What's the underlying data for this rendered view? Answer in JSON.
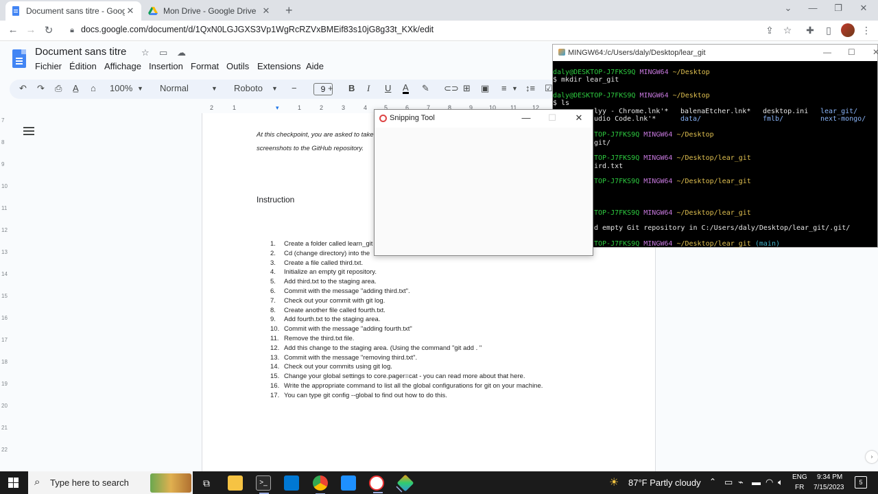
{
  "browser": {
    "tabs": [
      {
        "title": "Document sans titre - Google Do",
        "active": true
      },
      {
        "title": "Mon Drive - Google Drive",
        "active": false
      }
    ],
    "url": "docs.google.com/document/d/1QxN0LGJGXS3Vp1WgRcRZVxBMEif83s10jG8g33t_KXk/edit"
  },
  "docs": {
    "title": "Document sans titre",
    "menu": [
      "Fichier",
      "Édition",
      "Affichage",
      "Insertion",
      "Format",
      "Outils",
      "Extensions",
      "Aide"
    ],
    "toolbar": {
      "zoom": "100%",
      "style": "Normal",
      "font": "Roboto",
      "font_size": "9"
    },
    "ruler": [
      "2",
      "1",
      "1",
      "2",
      "3",
      "4",
      "5",
      "6",
      "7",
      "8",
      "9",
      "10",
      "11",
      "12",
      "13"
    ],
    "vruler": [
      "7",
      "8",
      "9",
      "10",
      "11",
      "12",
      "13",
      "14",
      "15",
      "16",
      "17",
      "18",
      "19",
      "20",
      "21",
      "22"
    ],
    "page": {
      "intro_line1": "At this checkpoint, you are asked to take",
      "intro_line2": "screenshots to the GitHub repository.",
      "heading": "Instruction",
      "steps": [
        {
          "n": "1.",
          "text": "Create a folder called learn_git"
        },
        {
          "n": "2.",
          "text": "Cd (change directory) into the"
        },
        {
          "n": "3.",
          "text": "Create a file called third.txt."
        },
        {
          "n": "4.",
          "text": "Initialize an empty git repository."
        },
        {
          "n": "5.",
          "text": "Add third.txt to the staging area."
        },
        {
          "n": "6.",
          "text": "Commit with the message \"adding third.txt\"."
        },
        {
          "n": "7.",
          "text": "Check out your commit with git log."
        },
        {
          "n": "8.",
          "text": "Create another file called fourth.txt."
        },
        {
          "n": "9.",
          "text": "Add fourth.txt to the staging area."
        },
        {
          "n": "10.",
          "text": "Commit with the message \"adding fourth.txt\""
        },
        {
          "n": "11.",
          "text": "Remove the third.txt file."
        },
        {
          "n": "12.",
          "text": "Add this change to the staging area. (Using the command \"git add . \""
        },
        {
          "n": "13.",
          "text": "Commit with the message \"removing third.txt\"."
        },
        {
          "n": "14.",
          "text": "Check out your commits using git log."
        },
        {
          "n": "15.",
          "text": "Change your global settings to core.pager=cat - you can read more about that here."
        },
        {
          "n": "16.",
          "text": "Write the appropriate command to list all the global configurations for git on your machine."
        },
        {
          "n": "17.",
          "text": "You can type git config --global to find out how to do this."
        }
      ]
    }
  },
  "terminal": {
    "title": "MINGW64:/c/Users/daly/Desktop/lear_git",
    "prompt_user": "daly@DESKTOP-J7FKS9Q",
    "prompt_env": "MINGW64",
    "desktop_path": "~/Desktop",
    "repo_path": "~/Desktop/lear_git",
    "cmd_mkdir": "$ mkdir lear_git",
    "cmd_ls": "$ ls",
    "ls_row1": [
      "lyy - Chrome.lnk'*",
      "balenaEtcher.lnk*",
      "desktop.ini",
      "lear_git/"
    ],
    "ls_row2": [
      "udio Code.lnk'*",
      "data/",
      "fmlb/",
      "next-mongo/"
    ],
    "frag_prompt": "TOP-J7FKS9Q",
    "frag_git": "git/",
    "frag_third": "ird.txt",
    "init_msg": "d empty Git repository in C:/Users/daly/Desktop/lear_git/.git/",
    "branch": "(main)"
  },
  "snipping": {
    "title": "Snipping Tool"
  },
  "taskbar": {
    "search_placeholder": "Type here to search",
    "weather": "87°F  Partly cloudy",
    "lang1": "ENG",
    "lang2": "FR",
    "time": "9:34 PM",
    "date": "7/15/2023",
    "notif": "5"
  }
}
